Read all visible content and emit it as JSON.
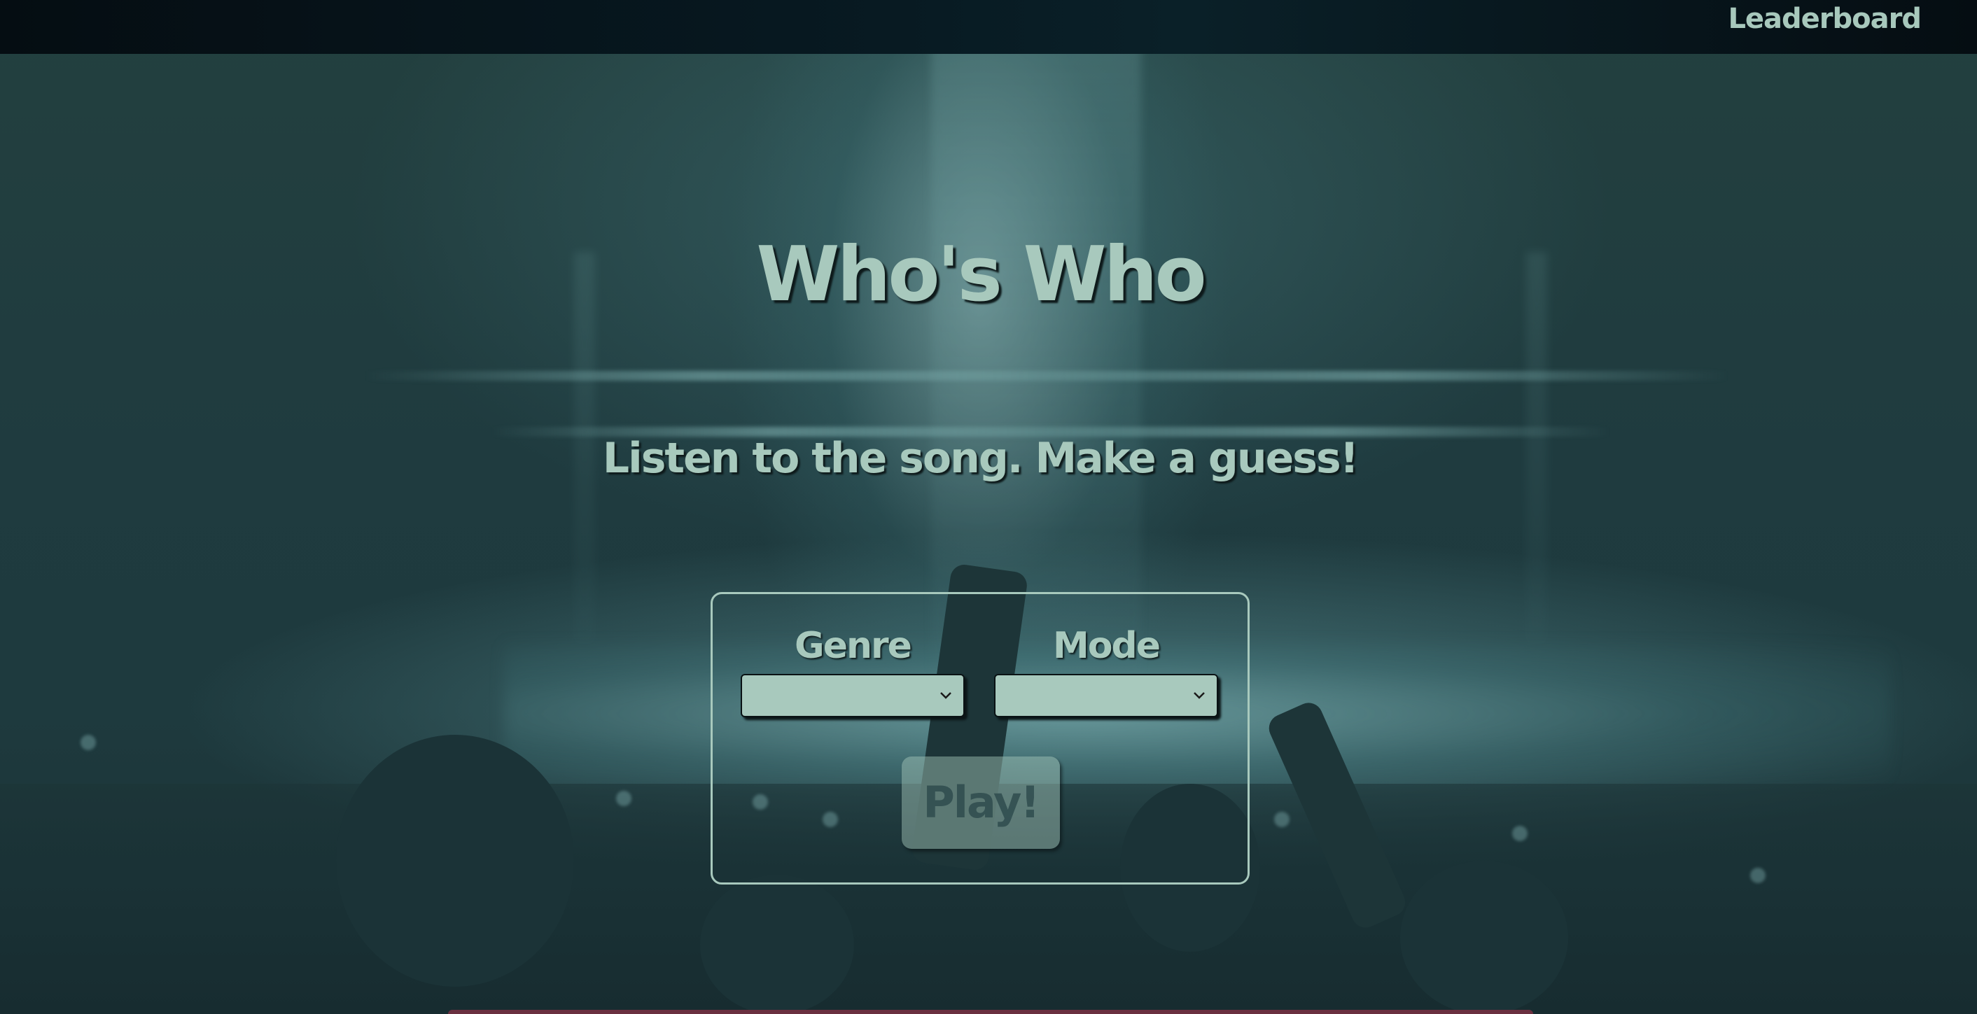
{
  "nav": {
    "leaderboard_label": "Leaderboard"
  },
  "hero": {
    "title": "Who's Who",
    "subtitle": "Listen to the song. Make a guess!"
  },
  "form": {
    "genre_label": "Genre",
    "genre_value": "",
    "mode_label": "Mode",
    "mode_value": "",
    "play_label": "Play!",
    "play_enabled": false
  },
  "colors": {
    "accent": "#a8c9bd",
    "topbar": "#050d12",
    "background": "#1f3a3e"
  },
  "icons": {
    "select_arrow": "chevron-down-icon"
  }
}
